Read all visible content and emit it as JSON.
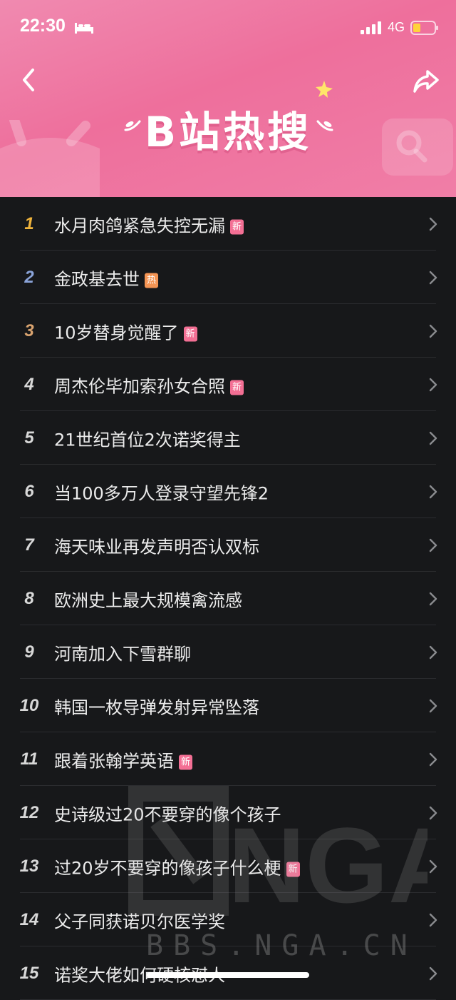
{
  "status": {
    "time": "22:30",
    "network": "4G"
  },
  "header": {
    "title": "B站热搜"
  },
  "colors": {
    "rank1": "#f0b43c",
    "rank2": "#8aa3d8",
    "rank3": "#d9a36f",
    "tag_new": "#f36f94",
    "tag_hot": "#f59554"
  },
  "list": [
    {
      "rank": "1",
      "title": "水月肉鸽紧急失控无漏",
      "tag": "新"
    },
    {
      "rank": "2",
      "title": "金政基去世",
      "tag": "热"
    },
    {
      "rank": "3",
      "title": "10岁替身觉醒了",
      "tag": "新"
    },
    {
      "rank": "4",
      "title": "周杰伦毕加索孙女合照",
      "tag": "新"
    },
    {
      "rank": "5",
      "title": "21世纪首位2次诺奖得主",
      "tag": ""
    },
    {
      "rank": "6",
      "title": "当100多万人登录守望先锋2",
      "tag": ""
    },
    {
      "rank": "7",
      "title": "海天味业再发声明否认双标",
      "tag": ""
    },
    {
      "rank": "8",
      "title": "欧洲史上最大规模禽流感",
      "tag": ""
    },
    {
      "rank": "9",
      "title": "河南加入下雪群聊",
      "tag": ""
    },
    {
      "rank": "10",
      "title": "韩国一枚导弹发射异常坠落",
      "tag": ""
    },
    {
      "rank": "11",
      "title": "跟着张翰学英语",
      "tag": "新"
    },
    {
      "rank": "12",
      "title": "史诗级过20不要穿的像个孩子",
      "tag": ""
    },
    {
      "rank": "13",
      "title": "过20岁不要穿的像孩子什么梗",
      "tag": "新"
    },
    {
      "rank": "14",
      "title": "父子同获诺贝尔医学奖",
      "tag": ""
    },
    {
      "rank": "15",
      "title": "诺奖大佬如何硬核怼人",
      "tag": ""
    }
  ],
  "watermark": {
    "brand": "NGA",
    "url": "BBS.NGA.CN"
  }
}
